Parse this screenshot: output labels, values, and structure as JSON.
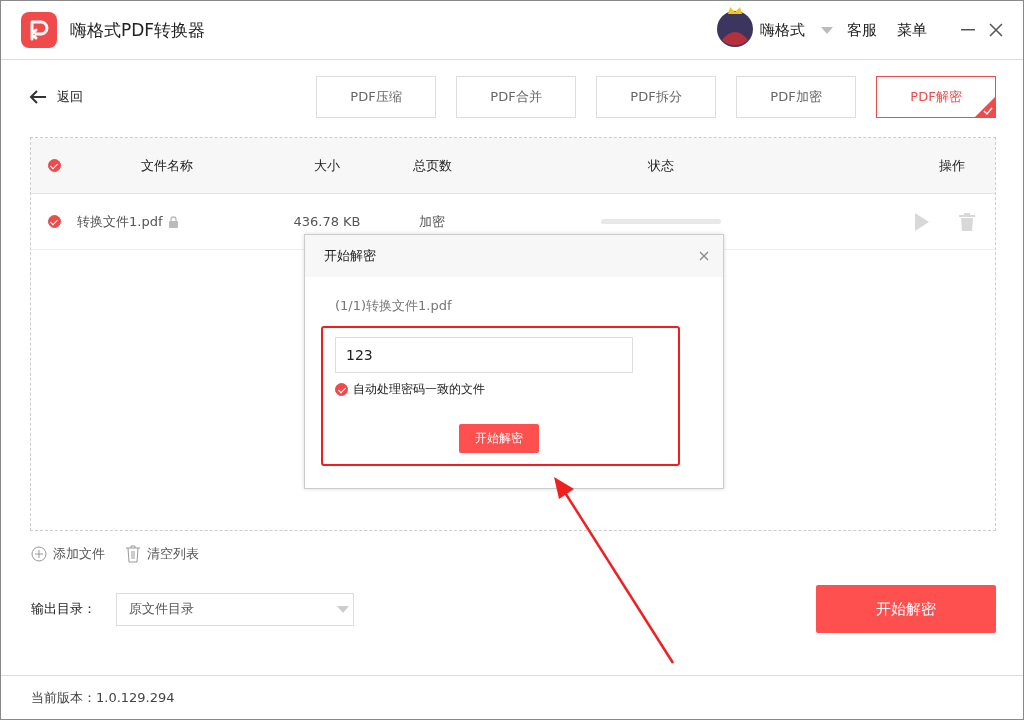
{
  "app": {
    "title": "嗨格式PDF转换器"
  },
  "user": {
    "name": "嗨格式"
  },
  "header_links": [
    "客服",
    "菜单"
  ],
  "back": "返回",
  "tools": [
    {
      "label": "PDF压缩",
      "selected": false
    },
    {
      "label": "PDF合并",
      "selected": false
    },
    {
      "label": "PDF拆分",
      "selected": false
    },
    {
      "label": "PDF加密",
      "selected": false
    },
    {
      "label": "PDF解密",
      "selected": true
    }
  ],
  "table": {
    "all_checked": true,
    "columns": [
      "文件名称",
      "大小",
      "总页数",
      "状态",
      "操作"
    ],
    "rows": [
      {
        "checked": true,
        "name": "转换文件1.pdf",
        "locked": true,
        "size": "436.78 KB",
        "pages": "加密",
        "level": 0
      }
    ]
  },
  "dialog": {
    "title": "开始解密",
    "file": "(1/1)转换文件1.pdf",
    "password": "123",
    "auto_option": {
      "label": "自动处理密码一致的文件",
      "checked": true
    },
    "button": "开始解密"
  },
  "list_actions": [
    {
      "kind": "add",
      "label": "添加文件"
    },
    {
      "kind": "clear",
      "label": "清空列表"
    }
  ],
  "output": {
    "label": "输出目录：",
    "value": "原文件目录"
  },
  "start_button": "开始解密",
  "version": "当前版本：1.0.129.294"
}
